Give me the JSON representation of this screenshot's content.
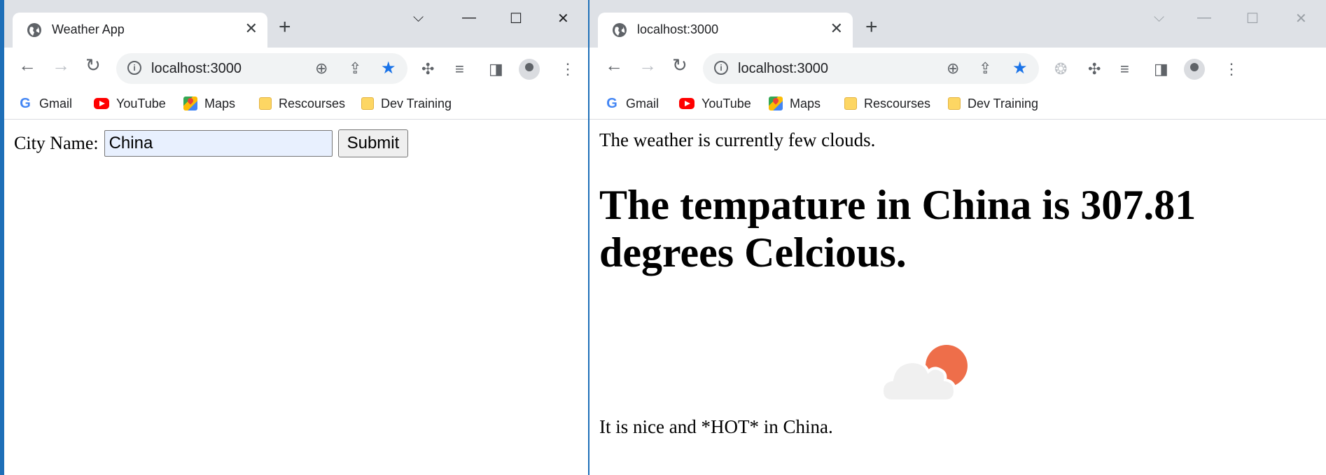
{
  "left_window": {
    "tab_title": "Weather App",
    "url": "localhost:3000",
    "bookmarks": [
      "Gmail",
      "YouTube",
      "Maps",
      "Rescourses",
      "Dev Training"
    ],
    "form": {
      "label": "City Name:",
      "input_value": "China",
      "submit_label": "Submit"
    }
  },
  "right_window": {
    "tab_title": "localhost:3000",
    "url": "localhost:3000",
    "bookmarks": [
      "Gmail",
      "YouTube",
      "Maps",
      "Rescourses",
      "Dev Training"
    ],
    "weather_text": "The weather is currently few clouds.",
    "temperature_heading": "The tempature in China is 307.81 degrees Celcious.",
    "footer_text": "It is nice and *HOT* in China.",
    "weather_icon": "few-clouds-icon"
  },
  "colors": {
    "accent": "#1a73e8",
    "tabstrip": "#dee1e6",
    "sun": "#ee6e4a",
    "cloud": "#f1f1f1"
  }
}
